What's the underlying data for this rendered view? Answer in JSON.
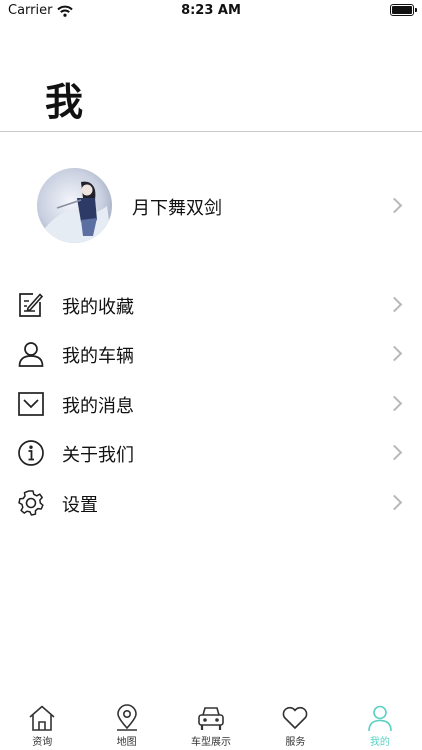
{
  "status_bar": {
    "carrier": "Carrier",
    "time": "8:23 AM"
  },
  "header": {
    "title": "我"
  },
  "profile": {
    "name": "月下舞双剑"
  },
  "menu": [
    {
      "label": "我的收藏",
      "icon": "edit-icon"
    },
    {
      "label": "我的车辆",
      "icon": "user-icon"
    },
    {
      "label": "我的消息",
      "icon": "mail-icon"
    },
    {
      "label": "关于我们",
      "icon": "info-icon"
    },
    {
      "label": "设置",
      "icon": "gear-icon"
    }
  ],
  "tabbar": {
    "active_color": "#5ad1c3",
    "tabs": [
      {
        "label": "资询",
        "icon": "home-icon"
      },
      {
        "label": "地图",
        "icon": "location-pin-icon"
      },
      {
        "label": "车型展示",
        "icon": "car-icon"
      },
      {
        "label": "服务",
        "icon": "heart-icon"
      },
      {
        "label": "我的",
        "icon": "person-icon",
        "active": true
      }
    ]
  }
}
